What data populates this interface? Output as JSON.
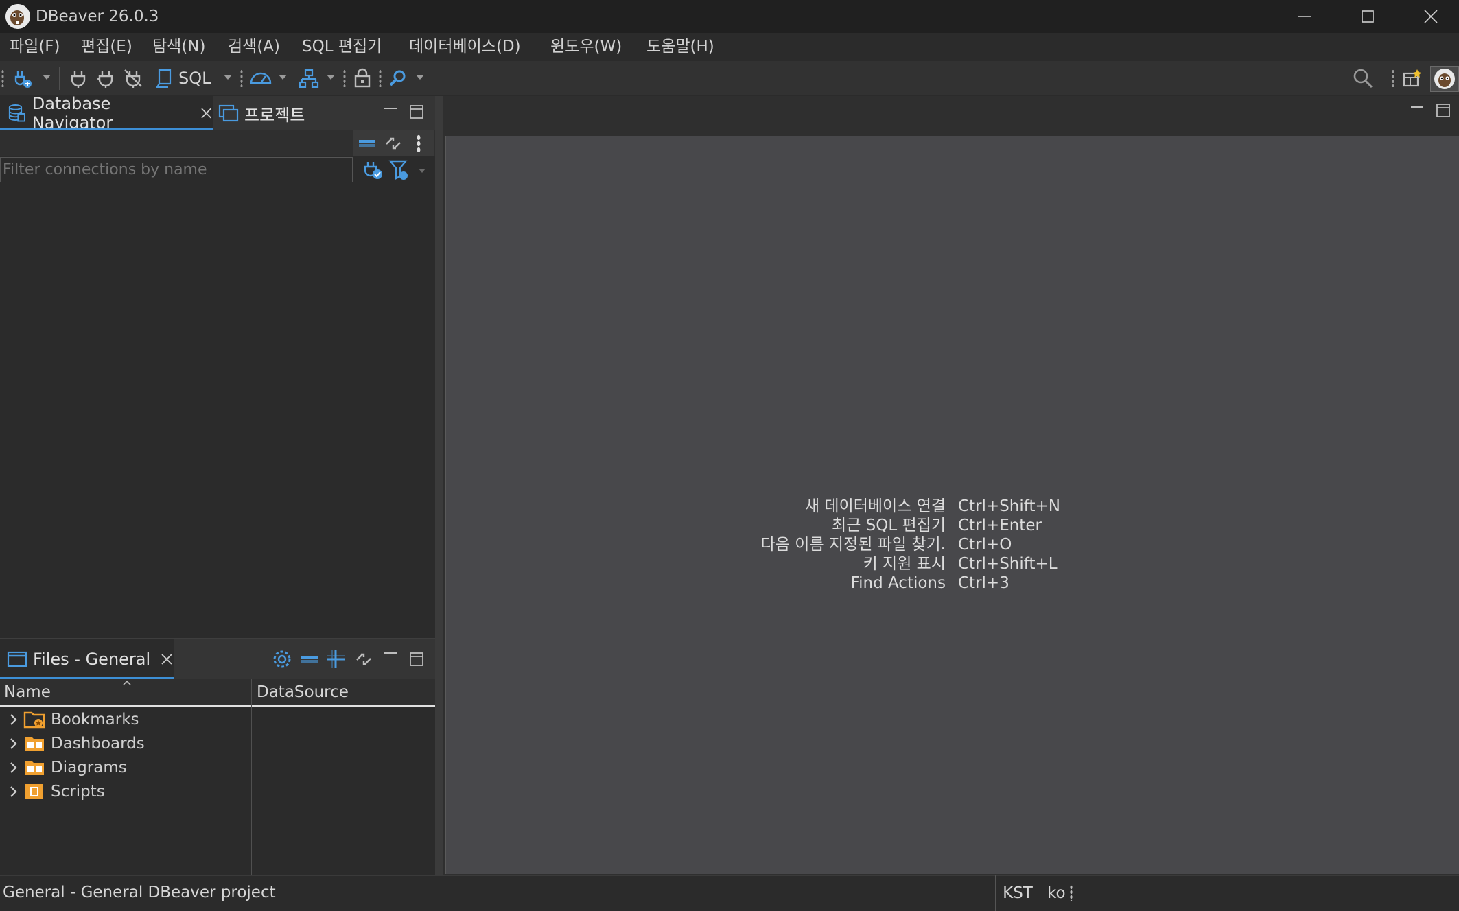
{
  "window": {
    "title": "DBeaver 26.0.3"
  },
  "menu": [
    "파일(F)",
    "편집(E)",
    "탐색(N)",
    "검색(A)",
    "SQL 편집기",
    "데이터베이스(D)",
    "윈도우(W)",
    "도움말(H)"
  ],
  "toolbar": {
    "sql_label": "SQL",
    "icons": [
      "new-connection-icon",
      "connect-icon",
      "reconnect-icon",
      "disconnect-icon",
      "sql-editor-icon",
      "dashboard-icon",
      "transaction-icon",
      "lock-icon",
      "search-icon",
      "global-search-icon",
      "perspective-icon",
      "avatar-icon"
    ]
  },
  "navigator": {
    "tab_label": "Database Navigator",
    "projects_tab_label": "프로젝트",
    "filter_placeholder": "Filter connections by name"
  },
  "files": {
    "tab_label": "Files - General",
    "columns": [
      "Name",
      "DataSource"
    ],
    "rows": [
      "Bookmarks",
      "Dashboards",
      "Diagrams",
      "Scripts"
    ]
  },
  "editor": {
    "shortcuts": [
      {
        "label": "새 데이터베이스 연결",
        "key": "Ctrl+Shift+N"
      },
      {
        "label": "최근 SQL 편집기",
        "key": "Ctrl+Enter"
      },
      {
        "label": "다음 이름 지정된 파일 찾기.",
        "key": "Ctrl+O"
      },
      {
        "label": "키 지원 표시",
        "key": "Ctrl+Shift+L"
      },
      {
        "label": "Find Actions",
        "key": "Ctrl+3"
      }
    ]
  },
  "status": {
    "project": "General - General DBeaver project",
    "timezone": "KST",
    "locale": "ko"
  },
  "colors": {
    "accent": "#3d8fd6",
    "folder": "#f0a030",
    "background": "#2b2b2b",
    "editor": "#48484b"
  }
}
